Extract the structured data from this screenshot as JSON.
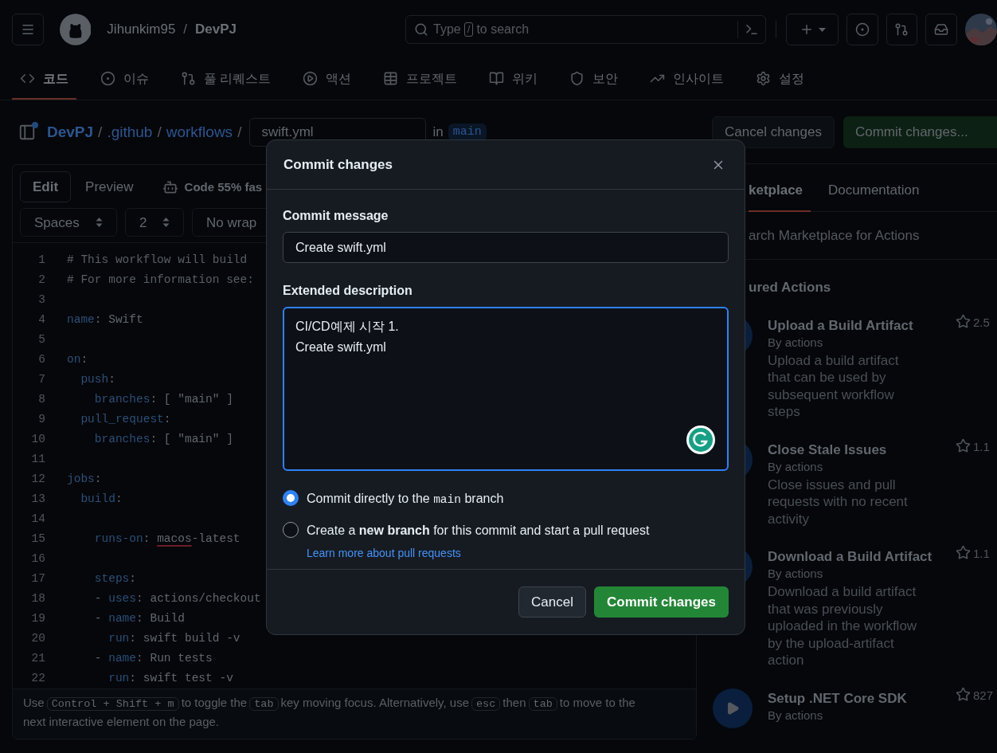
{
  "header": {
    "owner": "Jihunkim95",
    "separator": "/",
    "repo": "DevPJ",
    "search": {
      "before": "Type",
      "key": "/",
      "after": "to search"
    }
  },
  "nav": [
    {
      "label": "코드",
      "selected": true
    },
    {
      "label": "이슈",
      "selected": false
    },
    {
      "label": "풀 리퀘스트",
      "selected": false
    },
    {
      "label": "액션",
      "selected": false
    },
    {
      "label": "프로젝트",
      "selected": false
    },
    {
      "label": "위키",
      "selected": false
    },
    {
      "label": "보안",
      "selected": false
    },
    {
      "label": "인사이트",
      "selected": false
    },
    {
      "label": "설정",
      "selected": false
    }
  ],
  "breadcrumb": {
    "parts": [
      "DevPJ",
      ".github",
      "workflows"
    ],
    "separator": "/",
    "filename": "swift.yml",
    "in_label": "in",
    "branch": "main"
  },
  "actions": {
    "cancel": "Cancel changes",
    "commit": "Commit changes..."
  },
  "editor": {
    "tabs": [
      {
        "label": "Edit",
        "selected": true
      },
      {
        "label": "Preview",
        "selected": false
      }
    ],
    "copilot": "Code 55% fas",
    "selects": [
      "Spaces",
      "2",
      "No wrap"
    ],
    "lines": [
      {
        "n": "1",
        "segments": [
          {
            "t": "# This workflow will build",
            "kind": "comment"
          }
        ]
      },
      {
        "n": "2",
        "segments": [
          {
            "t": "# For more information see:",
            "kind": "comment"
          }
        ]
      },
      {
        "n": "3"
      },
      {
        "n": "4",
        "segments": [
          {
            "t": "name",
            "kind": "key"
          },
          {
            "t": ": Swift",
            "kind": "plain"
          }
        ]
      },
      {
        "n": "5"
      },
      {
        "n": "6",
        "segments": [
          {
            "t": "on",
            "kind": "key"
          },
          {
            "t": ":",
            "kind": "plain"
          }
        ]
      },
      {
        "n": "7",
        "segments": [
          {
            "t": "  push",
            "kind": "key"
          },
          {
            "t": ":",
            "kind": "plain"
          }
        ]
      },
      {
        "n": "8",
        "segments": [
          {
            "t": "    branches",
            "kind": "key"
          },
          {
            "t": ": [ \"main\" ]",
            "kind": "plain"
          }
        ]
      },
      {
        "n": "9",
        "segments": [
          {
            "t": "  pull_request",
            "kind": "key"
          },
          {
            "t": ":",
            "kind": "plain"
          }
        ]
      },
      {
        "n": "10",
        "segments": [
          {
            "t": "    branches",
            "kind": "key"
          },
          {
            "t": ": [ \"main\" ]",
            "kind": "plain"
          }
        ]
      },
      {
        "n": "11"
      },
      {
        "n": "12",
        "segments": [
          {
            "t": "jobs",
            "kind": "key"
          },
          {
            "t": ":",
            "kind": "plain"
          }
        ]
      },
      {
        "n": "13",
        "segments": [
          {
            "t": "  build",
            "kind": "key"
          },
          {
            "t": ":",
            "kind": "plain"
          }
        ]
      },
      {
        "n": "14"
      },
      {
        "n": "15",
        "segments": [
          {
            "t": "    runs-on",
            "kind": "key"
          },
          {
            "t": ": ",
            "kind": "plain"
          },
          {
            "t": "macos",
            "kind": "flagged"
          },
          {
            "t": "-latest",
            "kind": "plain"
          }
        ]
      },
      {
        "n": "16"
      },
      {
        "n": "17",
        "segments": [
          {
            "t": "    steps",
            "kind": "key"
          },
          {
            "t": ":",
            "kind": "plain"
          }
        ]
      },
      {
        "n": "18",
        "segments": [
          {
            "t": "    - ",
            "kind": "plain"
          },
          {
            "t": "uses",
            "kind": "key"
          },
          {
            "t": ": actions/checkout",
            "kind": "plain"
          }
        ]
      },
      {
        "n": "19",
        "segments": [
          {
            "t": "    - ",
            "kind": "plain"
          },
          {
            "t": "name",
            "kind": "key"
          },
          {
            "t": ": Build",
            "kind": "plain"
          }
        ]
      },
      {
        "n": "20",
        "segments": [
          {
            "t": "      run",
            "kind": "key"
          },
          {
            "t": ": swift build -v",
            "kind": "plain"
          }
        ]
      },
      {
        "n": "21",
        "segments": [
          {
            "t": "    - ",
            "kind": "plain"
          },
          {
            "t": "name",
            "kind": "key"
          },
          {
            "t": ": Run tests",
            "kind": "plain"
          }
        ]
      },
      {
        "n": "22",
        "segments": [
          {
            "t": "      run",
            "kind": "key"
          },
          {
            "t": ": swift test -v",
            "kind": "plain"
          }
        ]
      }
    ],
    "hint": [
      {
        "t": "Use",
        "kind": "text"
      },
      {
        "t": "Control + Shift + m",
        "kind": "kbd"
      },
      {
        "t": "to toggle the",
        "kind": "text"
      },
      {
        "t": "tab",
        "kind": "kbd"
      },
      {
        "t": "key moving focus. Alternatively, use",
        "kind": "text"
      },
      {
        "t": "esc",
        "kind": "kbd"
      },
      {
        "t": "then",
        "kind": "text"
      },
      {
        "t": "tab",
        "kind": "kbd"
      },
      {
        "t": "to move to the next interactive element on the page.",
        "kind": "text"
      }
    ]
  },
  "side_panel": {
    "tabs": [
      {
        "label": "ketplace",
        "selected": true
      },
      {
        "label": "Documentation",
        "selected": false
      }
    ],
    "search_placeholder": "arch Marketplace for Actions",
    "heading": "ured Actions",
    "items": [
      {
        "title": "Upload a Build Artifact",
        "by": "By actions",
        "description": "Upload a build artifact that can be used by subsequent workflow steps",
        "stars": "2.5"
      },
      {
        "title": "Close Stale Issues",
        "by": "By actions",
        "description": "Close issues and pull requests with no recent activity",
        "stars": "1.1"
      },
      {
        "title": "Download a Build Artifact",
        "by": "By actions",
        "description": "Download a build artifact that was previously uploaded in the workflow by the upload-artifact action",
        "stars": "1.1"
      },
      {
        "title": "Setup .NET Core SDK",
        "by": "By actions",
        "stars": "827"
      }
    ]
  },
  "dialog": {
    "title": "Commit changes",
    "message_label": "Commit message",
    "message": "Create swift.yml",
    "description_label": "Extended description",
    "description": "CI/CD예제 시작 1.\nCreate swift.yml",
    "options": [
      {
        "selected": true,
        "segments": [
          {
            "t": "Commit directly to the ",
            "kind": "text"
          },
          {
            "t": "main",
            "kind": "code"
          },
          {
            "t": " branch",
            "kind": "text"
          }
        ]
      },
      {
        "selected": false,
        "text": "Create a **new branch** for this commit and start a pull request",
        "link": "Learn more about pull requests"
      }
    ],
    "cancel": "Cancel",
    "commit": "Commit changes"
  }
}
